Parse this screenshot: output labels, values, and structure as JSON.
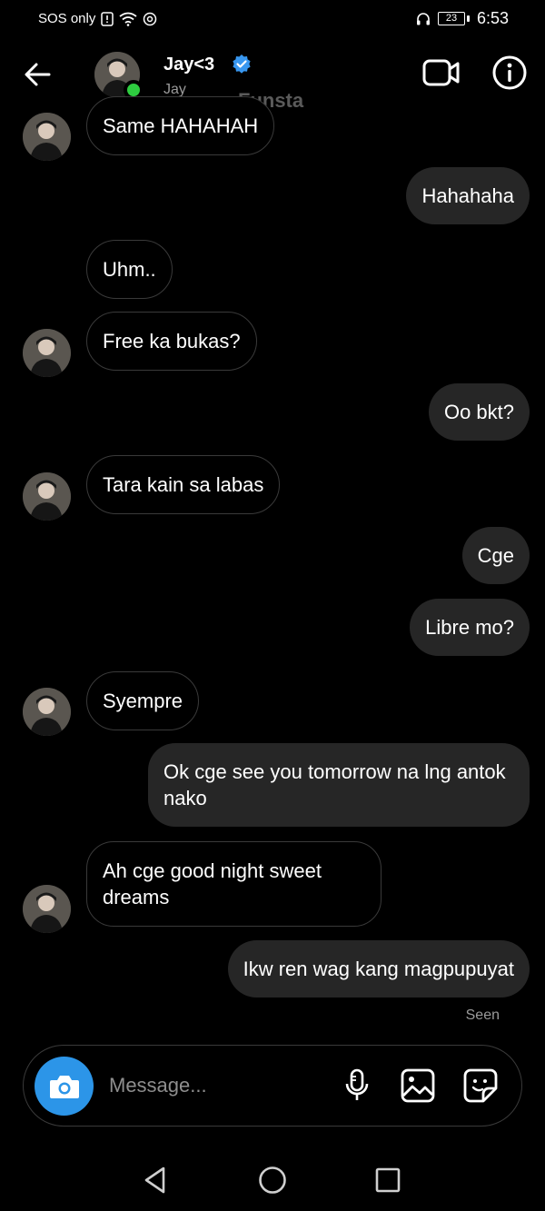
{
  "status_bar": {
    "carrier": "SOS only",
    "battery": "23",
    "time": "6:53"
  },
  "header": {
    "name": "Jay<3",
    "username": "Jay",
    "watermark": "Funsta"
  },
  "messages": [
    {
      "side": "in",
      "text": "Same HAHAHAH",
      "avatar": true
    },
    {
      "side": "out",
      "text": "Hahahaha"
    },
    {
      "side": "in",
      "text": "Uhm..",
      "avatar": false
    },
    {
      "side": "in",
      "text": "Free ka bukas?",
      "avatar": true
    },
    {
      "side": "out",
      "text": "Oo bkt?"
    },
    {
      "side": "in",
      "text": "Tara kain sa labas",
      "avatar": true
    },
    {
      "side": "out",
      "text": "Cge"
    },
    {
      "side": "out",
      "text": "Libre mo?"
    },
    {
      "side": "in",
      "text": "Syempre",
      "avatar": true
    },
    {
      "side": "out",
      "text": "Ok cge see you tomorrow na lng antok nako"
    },
    {
      "side": "in",
      "text": "Ah cge good night sweet dreams",
      "avatar": true
    },
    {
      "side": "out",
      "text": "Ikw ren wag kang magpupuyat"
    }
  ],
  "seen_label": "Seen",
  "composer": {
    "placeholder": "Message..."
  },
  "colors": {
    "background": "#000000",
    "outgoing_bubble": "#262626",
    "camera_button": "#2c95e8",
    "online": "#2ecc40",
    "verified": "#3897f0"
  }
}
